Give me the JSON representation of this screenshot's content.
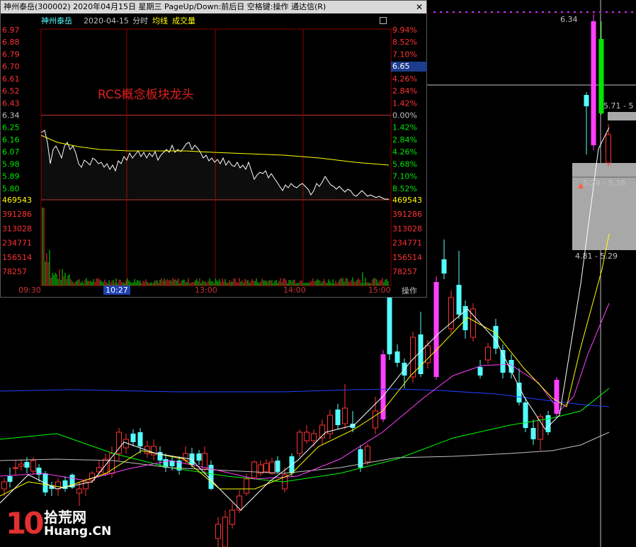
{
  "window": {
    "title": "神州泰岳(300002) 2020年04月15日 星期三 PageUp/Down:前后日 空格键:操作 通达信(R)",
    "close_label": "✕"
  },
  "minute_chart": {
    "stock_name": "神州泰岳",
    "date": "2020-04-15",
    "mode": "分时",
    "avg_label": "均线",
    "volume_label": "成交量",
    "current_price": "6.65",
    "annotation": "RCS概念板块龙头",
    "operate_label": "操作",
    "price_labels": [
      "6.97",
      "6.88",
      "6.79",
      "6.70",
      "6.61",
      "6.52",
      "6.43",
      "6.34",
      "6.25",
      "6.16",
      "6.07",
      "5.98",
      "5.89",
      "5.80"
    ],
    "pct_labels": [
      "9.94%",
      "8.52%",
      "7.10%",
      "5.68%",
      "4.26%",
      "2.84%",
      "1.42%",
      "0.00%",
      "1.42%",
      "2.84%",
      "4.26%",
      "5.68%",
      "7.10%",
      "8.52%"
    ],
    "volume_labels": [
      "469543",
      "391286",
      "313028",
      "234771",
      "156514",
      "78257"
    ],
    "time_labels": [
      "09:30",
      "10:27",
      "13:00",
      "14:00",
      "15:00"
    ],
    "colors": {
      "up": "#ff3232",
      "down": "#00e600",
      "price_line": "#ffffff",
      "avg_line": "#ffff00",
      "grid": "#8b0000"
    }
  },
  "kline": {
    "top_price": "6.34",
    "box_upper": "5.71 - 5",
    "box_mid": "5.29 - 5.38",
    "box_lower": "4.81 - 5.29",
    "colors": {
      "up": "#ff3232",
      "down": "#54ffff",
      "limit_up": "#ff40ff",
      "ma5": "#ffffff",
      "ma10": "#ffff00",
      "ma20": "#ff40ff",
      "ma60": "#00ff00",
      "ma120": "#c0c0c0",
      "ma250": "#2040ff"
    }
  },
  "watermark": {
    "logo_number": "10",
    "logo_cn": "拾荒网",
    "logo_en": "Huang.CN"
  }
}
